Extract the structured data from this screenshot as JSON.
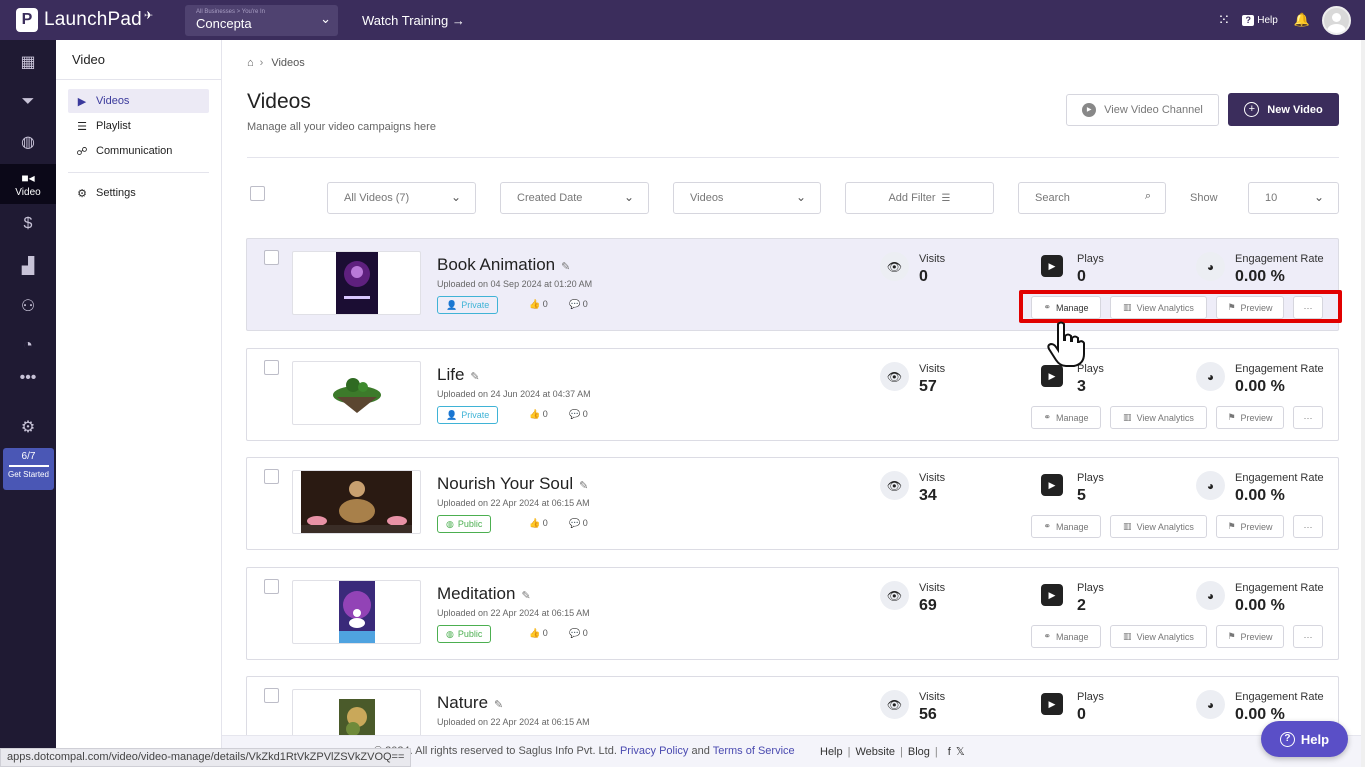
{
  "brand": {
    "name": "LaunchPad"
  },
  "business": {
    "sublabel": "All Businesses > You're In",
    "name": "Concepta"
  },
  "topbar": {
    "watch_training": "Watch Training →",
    "help": "Help"
  },
  "sidenav": {
    "video_label": "Video",
    "progress": "6/7",
    "get_started": "Get Started"
  },
  "subnav": {
    "title": "Video",
    "items": [
      {
        "label": "Videos",
        "icon": "video-icon"
      },
      {
        "label": "Playlist",
        "icon": "playlist-icon"
      },
      {
        "label": "Communication",
        "icon": "chat-icon"
      }
    ],
    "settings": "Settings"
  },
  "breadcrumb": {
    "current": "Videos"
  },
  "page": {
    "title": "Videos",
    "subtitle": "Manage all your video campaigns here"
  },
  "buttons": {
    "view_channel": "View Video Channel",
    "new_video": "New Video"
  },
  "filters": {
    "all_videos": "All Videos (7)",
    "created_date": "Created Date",
    "type": "Videos",
    "add_filter": "Add Filter",
    "search_placeholder": "Search",
    "show_label": "Show",
    "show_value": "10"
  },
  "labels": {
    "visits": "Visits",
    "plays": "Plays",
    "engagement": "Engagement Rate",
    "manage": "Manage",
    "analytics": "View Analytics",
    "preview": "Preview",
    "more": "···"
  },
  "videos": [
    {
      "title": "Book Animation",
      "uploaded": "Uploaded on 04 Sep 2024 at 01:20 AM",
      "visibility": "Private",
      "likes": "0",
      "comments": "0",
      "visits": "0",
      "plays": "0",
      "engagement": "0.00 %"
    },
    {
      "title": "Life",
      "uploaded": "Uploaded on 24 Jun 2024 at 04:37 AM",
      "visibility": "Private",
      "likes": "0",
      "comments": "0",
      "visits": "57",
      "plays": "3",
      "engagement": "0.00 %"
    },
    {
      "title": "Nourish Your Soul",
      "uploaded": "Uploaded on 22 Apr 2024 at 06:15 AM",
      "visibility": "Public",
      "likes": "0",
      "comments": "0",
      "visits": "34",
      "plays": "5",
      "engagement": "0.00 %"
    },
    {
      "title": "Meditation",
      "uploaded": "Uploaded on 22 Apr 2024 at 06:15 AM",
      "visibility": "Public",
      "likes": "0",
      "comments": "0",
      "visits": "69",
      "plays": "2",
      "engagement": "0.00 %"
    },
    {
      "title": "Nature",
      "uploaded": "Uploaded on 22 Apr 2024 at 06:15 AM",
      "visibility": "",
      "likes": "",
      "comments": "",
      "visits": "56",
      "plays": "0",
      "engagement": "0.00 %"
    }
  ],
  "footer": {
    "copyright": "© 2024. All rights reserved to Saglus Info Pvt. Ltd.",
    "privacy": "Privacy Policy",
    "and": "and",
    "terms": "Terms of Service",
    "help": "Help",
    "website": "Website",
    "blog": "Blog"
  },
  "status_url": "apps.dotcompal.com/video/video-manage/details/VkZkd1RtVkZPVlZSVkZVOQ==",
  "help_fab": "Help",
  "colors": {
    "topbar": "#3b2d5c",
    "sidenav": "#1f1a33",
    "accent": "#3b2d5c",
    "highlight_box": "#e10000",
    "private": "#3fb3d6",
    "public": "#4caf50"
  }
}
